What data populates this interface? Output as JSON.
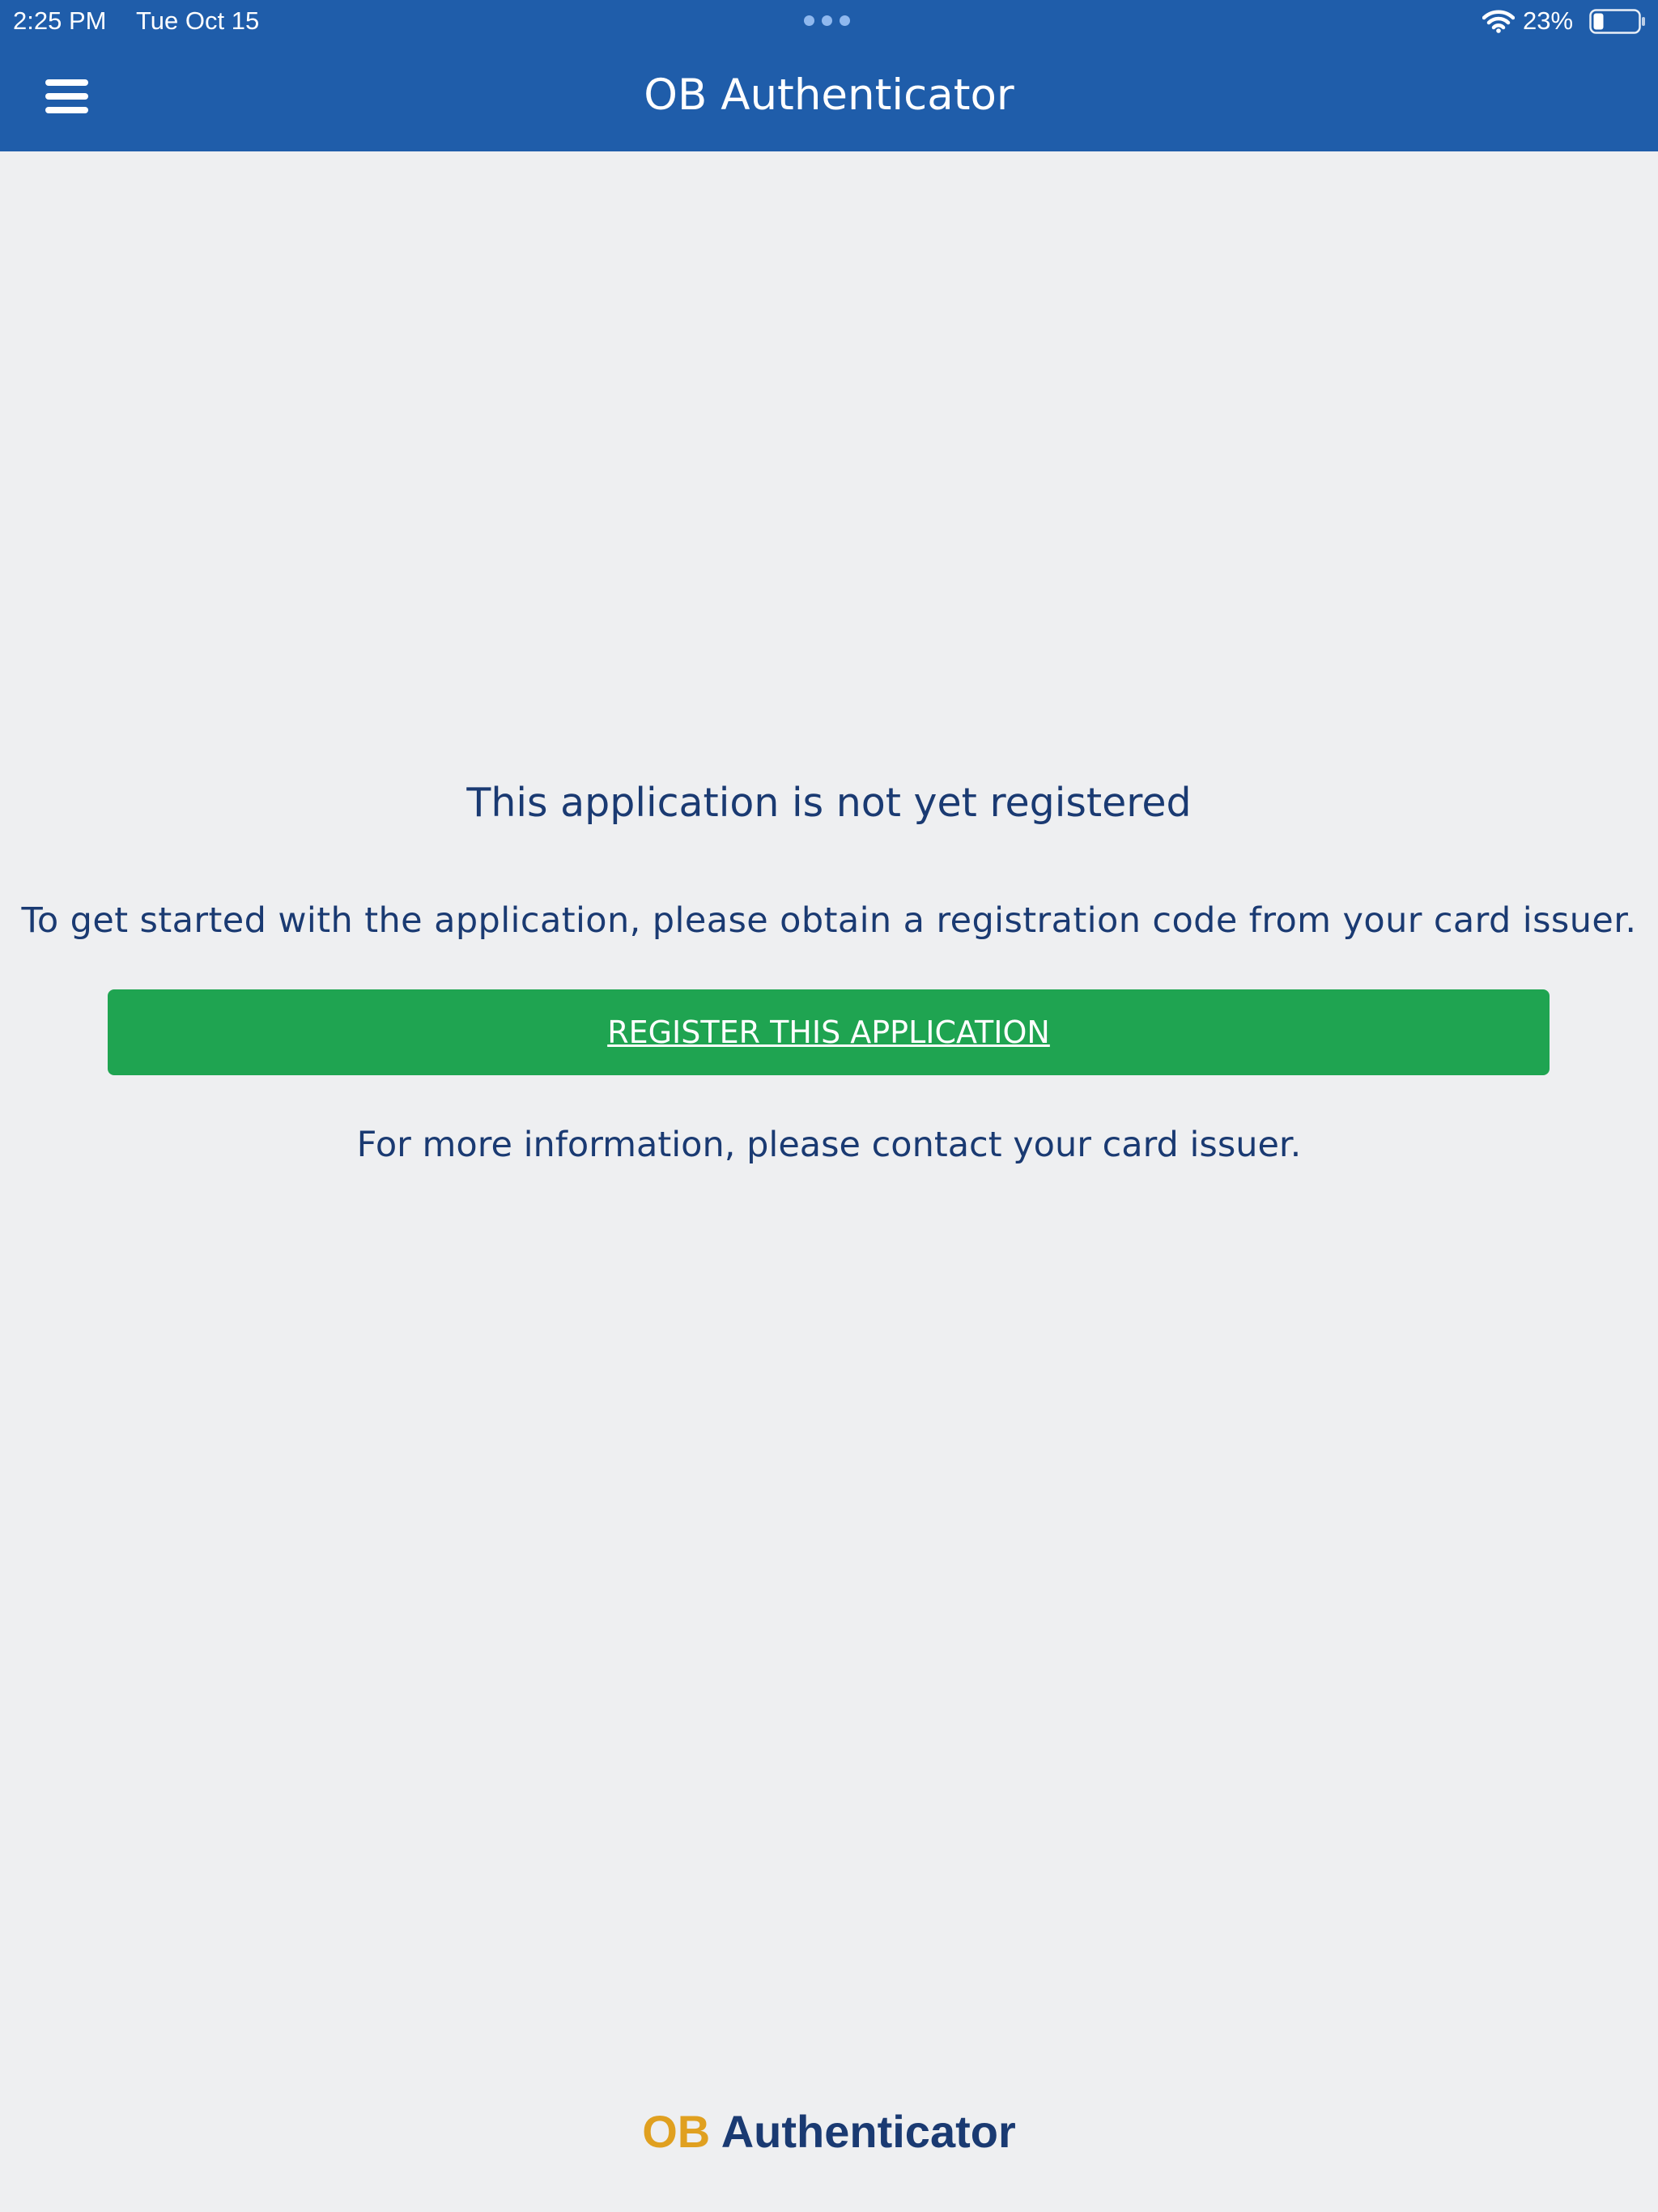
{
  "status_bar": {
    "time": "2:25 PM",
    "date": "Tue Oct 15",
    "battery_percent": "23%",
    "battery_level": 0.23,
    "icons": [
      "multitask-dots-icon",
      "wifi-icon",
      "battery-icon"
    ]
  },
  "header": {
    "title": "OB Authenticator",
    "menu_icon": "hamburger-menu-icon",
    "background_color": "#1f5daa"
  },
  "main": {
    "headline": "This application is not yet registered",
    "instructions": "To get started with the application, please obtain a registration code from your card issuer.",
    "register_button_label": "REGISTER THIS APPLICATION",
    "register_button_color": "#1fa451",
    "more_info": "For more information, please contact your card issuer.",
    "text_color": "#1a3a72"
  },
  "footer": {
    "logo_part_1": "OB",
    "logo_part_2": "Authenticator",
    "logo_part_1_color": "#e0a020",
    "logo_part_2_color": "#1a3a72"
  }
}
